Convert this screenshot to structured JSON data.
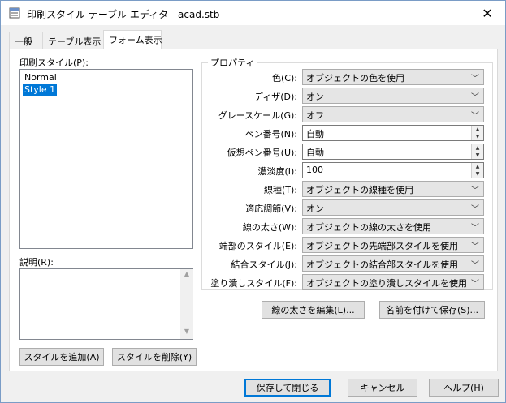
{
  "window": {
    "title": "印刷スタイル テーブル エディタ - acad.stb",
    "close_glyph": "✕"
  },
  "tabs": [
    {
      "label": "一般"
    },
    {
      "label": "テーブル表示"
    },
    {
      "label": "フォーム表示"
    }
  ],
  "styles": {
    "label": "印刷スタイル(P):",
    "items": [
      "Normal",
      "Style 1"
    ],
    "selected": "Style 1"
  },
  "description": {
    "label": "説明(R):",
    "value": ""
  },
  "buttons": {
    "add_style": "スタイルを追加(A)",
    "delete_style": "スタイルを削除(Y)",
    "edit_lineweights": "線の太さを編集(L)...",
    "save_as": "名前を付けて保存(S)...",
    "save_close": "保存して閉じる",
    "cancel": "キャンセル",
    "help": "ヘルプ(H)"
  },
  "properties": {
    "group_title": "プロパティ",
    "rows": [
      {
        "label": "色(C):",
        "value": "オブジェクトの色を使用",
        "kind": "combo"
      },
      {
        "label": "ディザ(D):",
        "value": "オン",
        "kind": "combo"
      },
      {
        "label": "グレースケール(G):",
        "value": "オフ",
        "kind": "combo"
      },
      {
        "label": "ペン番号(N):",
        "value": "自動",
        "kind": "spin"
      },
      {
        "label": "仮想ペン番号(U):",
        "value": "自動",
        "kind": "spin"
      },
      {
        "label": "濃淡度(I):",
        "value": "100",
        "kind": "spin"
      },
      {
        "label": "線種(T):",
        "value": "オブジェクトの線種を使用",
        "kind": "combo"
      },
      {
        "label": "適応調節(V):",
        "value": "オン",
        "kind": "combo"
      },
      {
        "label": "線の太さ(W):",
        "value": "オブジェクトの線の太さを使用",
        "kind": "combo"
      },
      {
        "label": "端部のスタイル(E):",
        "value": "オブジェクトの先端部スタイルを使用",
        "kind": "combo"
      },
      {
        "label": "結合スタイル(J):",
        "value": "オブジェクトの結合部スタイルを使用",
        "kind": "combo"
      },
      {
        "label": "塗り潰しスタイル(F):",
        "value": "オブジェクトの塗り潰しスタイルを使用",
        "kind": "combo"
      }
    ]
  }
}
